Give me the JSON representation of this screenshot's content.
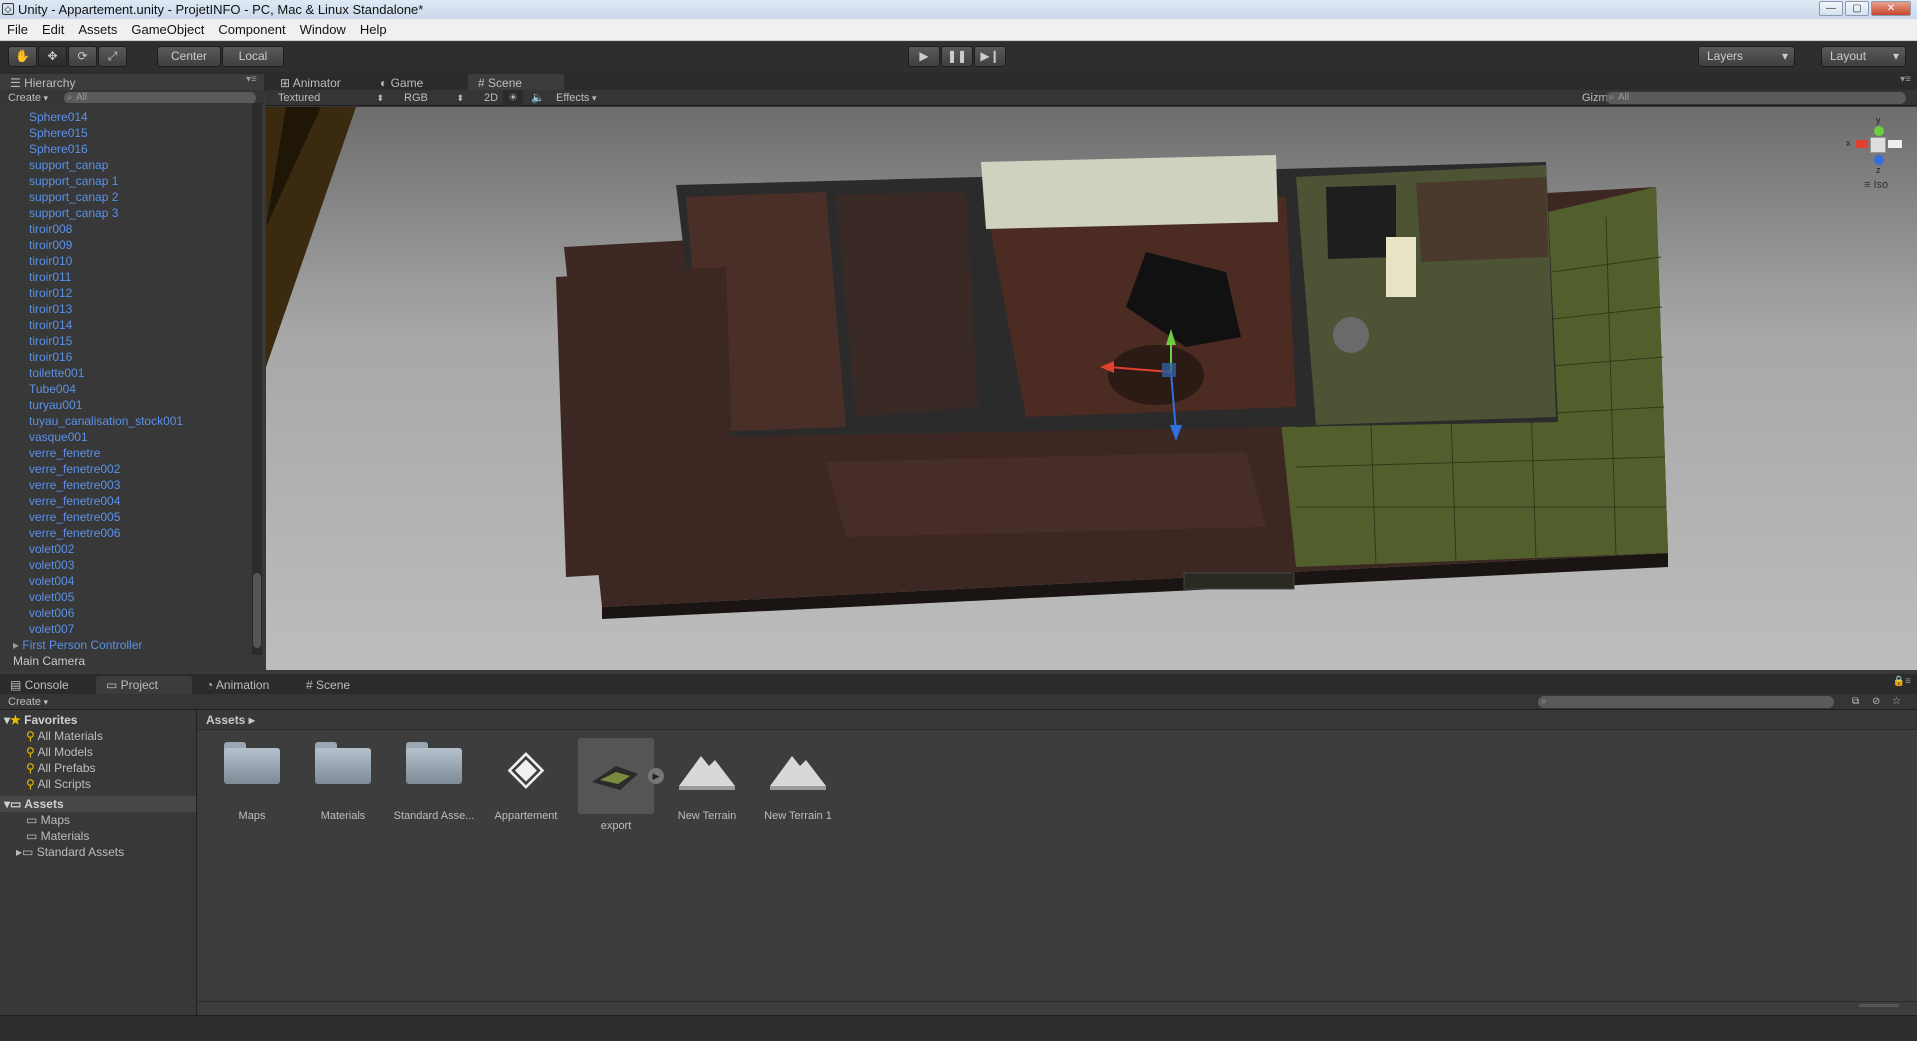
{
  "window": {
    "title": "Unity - Appartement.unity - ProjetINFO - PC, Mac & Linux Standalone*"
  },
  "menu": [
    "File",
    "Edit",
    "Assets",
    "GameObject",
    "Component",
    "Window",
    "Help"
  ],
  "toolbar": {
    "center_label": "Center",
    "local_label": "Local",
    "layers_label": "Layers",
    "layout_label": "Layout"
  },
  "scene_tabs": [
    "Hierarchy",
    "Animator",
    "Game",
    "Scene"
  ],
  "hierarchy": {
    "create_label": "Create",
    "search_placeholder": "All",
    "items": [
      "Sphere014",
      "Sphere015",
      "Sphere016",
      "support_canap",
      "support_canap 1",
      "support_canap 2",
      "support_canap 3",
      "tiroir008",
      "tiroir009",
      "tiroir010",
      "tiroir011",
      "tiroir012",
      "tiroir013",
      "tiroir014",
      "tiroir015",
      "tiroir016",
      "toilette001",
      "Tube004",
      "turyau001",
      "tuyau_canalisation_stock001",
      "vasque001",
      "verre_fenetre",
      "verre_fenetre002",
      "verre_fenetre003",
      "verre_fenetre004",
      "verre_fenetre005",
      "verre_fenetre006",
      "volet002",
      "volet003",
      "volet004",
      "volet005",
      "volet006",
      "volet007"
    ],
    "root_items": [
      "First Person Controller",
      "Main Camera"
    ]
  },
  "scene_bar": {
    "shading": "Textured",
    "render": "RGB",
    "mode_2d": "2D",
    "effects": "Effects",
    "gizmos": "Gizmos",
    "search_placeholder": "All",
    "gizmo_label": "Iso",
    "axis_y": "y",
    "axis_z": "z",
    "axis_x": "x"
  },
  "bottom_tabs": [
    "Console",
    "Project",
    "Animation",
    "Scene"
  ],
  "project": {
    "create_label": "Create",
    "favorites_label": "Favorites",
    "favorites": [
      "All Materials",
      "All Models",
      "All Prefabs",
      "All Scripts"
    ],
    "assets_label": "Assets",
    "asset_folders": [
      "Maps",
      "Materials",
      "Standard Assets"
    ],
    "breadcrumb": "Assets",
    "assets": [
      "Maps",
      "Materials",
      "Standard Asse...",
      "Appartement",
      "export",
      "New Terrain",
      "New Terrain 1"
    ]
  }
}
